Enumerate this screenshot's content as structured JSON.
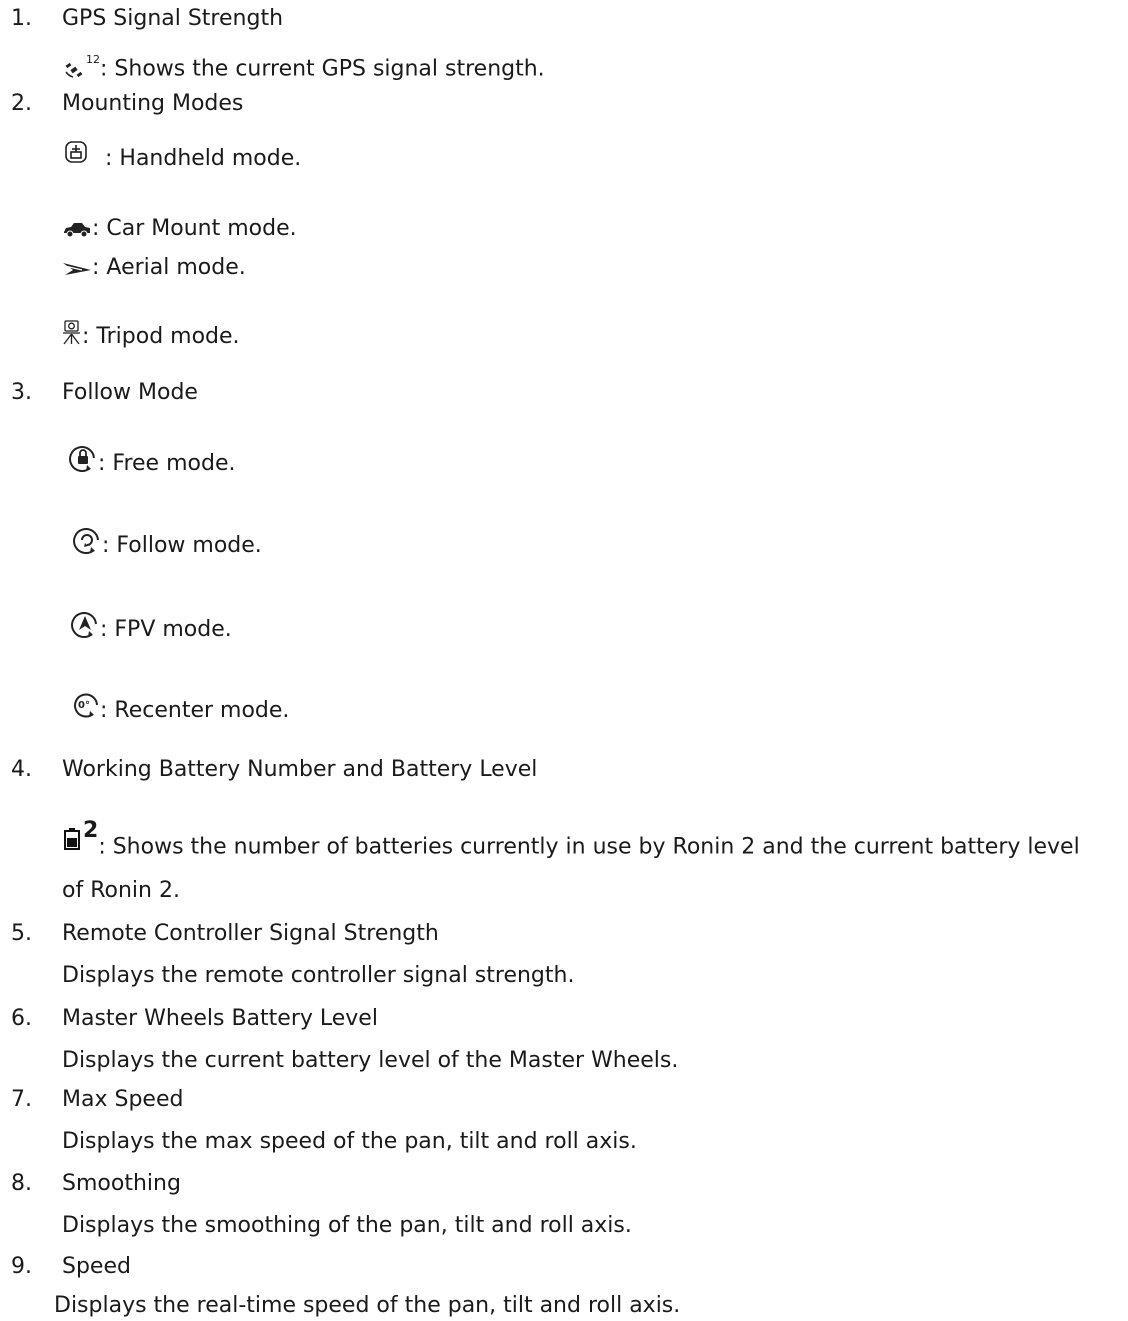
{
  "sections": [
    {
      "number": "1.",
      "title": "GPS Signal Strength"
    },
    {
      "number": "2.",
      "title": "Mounting Modes"
    },
    {
      "number": "3.",
      "title": "Follow Mode"
    },
    {
      "number": "4.",
      "title": "Working Battery Number and Battery Level"
    },
    {
      "number": "5.",
      "title": "Remote Controller Signal Strength"
    },
    {
      "number": "6.",
      "title": "Master Wheels Battery Level"
    },
    {
      "number": "7.",
      "title": "Max Speed"
    },
    {
      "number": "8.",
      "title": "Smoothing"
    },
    {
      "number": "9.",
      "title": "Speed"
    }
  ],
  "gps": {
    "icon": "gps-satellite-icon",
    "superscript": "12",
    "desc": ": Shows the current GPS signal strength."
  },
  "mounting": [
    {
      "icon": "handheld-icon",
      "text": " : Handheld mode."
    },
    {
      "icon": "car-icon",
      "text": ": Car Mount mode."
    },
    {
      "icon": "aerial-icon",
      "text": ": Aerial mode."
    },
    {
      "icon": "tripod-icon",
      "text": ": Tripod mode."
    }
  ],
  "follow": [
    {
      "icon": "free-lock-icon",
      "text": ": Free mode."
    },
    {
      "icon": "follow-circle-icon",
      "text": ": Follow mode."
    },
    {
      "icon": "fpv-icon",
      "text": ": FPV mode."
    },
    {
      "icon": "recenter-icon",
      "icon_text": "0°",
      "text": ": Recenter mode."
    }
  ],
  "battery": {
    "icon": "battery-icon",
    "superscript": "2",
    "desc": ": Shows the number of batteries currently in use by Ronin 2 and the current battery level",
    "desc2": "of Ronin 2."
  },
  "descriptions": {
    "s5": "Displays the remote controller signal strength.",
    "s6": "Displays the current battery level of the Master Wheels.",
    "s7": "Displays the max speed of the pan, tilt and roll axis.",
    "s8": "Displays the smoothing of the pan, tilt and roll axis.",
    "s9": "Displays the real-time speed of the pan, tilt and roll axis."
  }
}
